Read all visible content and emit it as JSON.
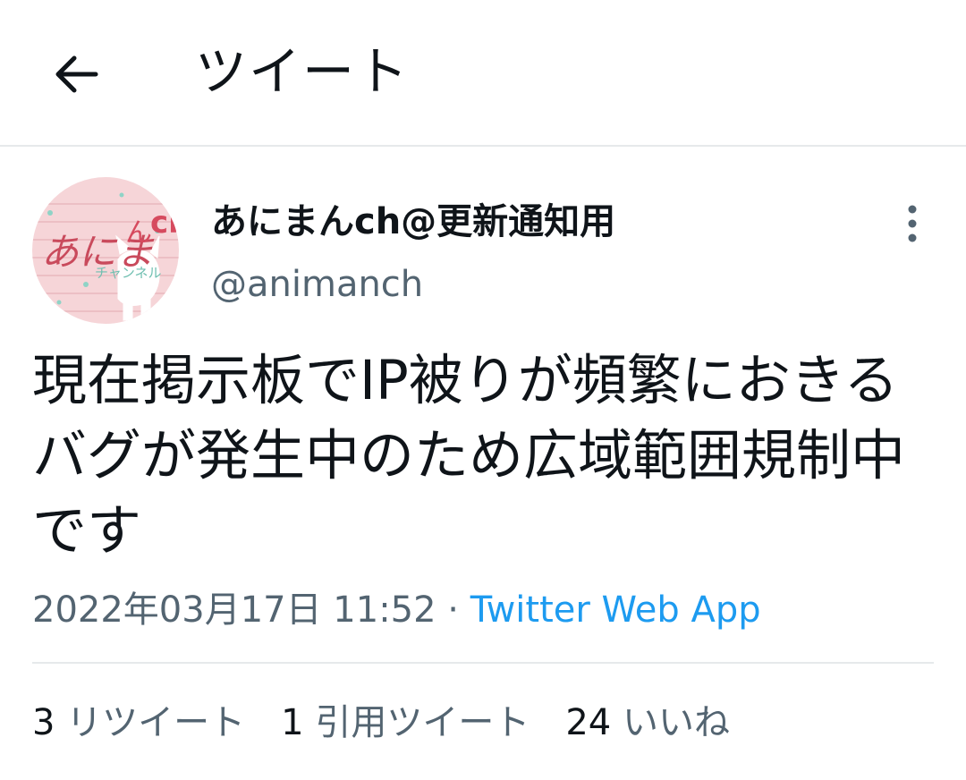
{
  "header": {
    "title": "ツイート",
    "back_icon": "arrow-left-icon"
  },
  "user": {
    "display_name": "あにまんch@更新通知用",
    "handle": "@animanch",
    "avatar_text": "あにまんch",
    "avatar_sub": "チャンネル"
  },
  "tweet": {
    "text": "現在掲示板でIP被りが頻繁におきるバグが発生中のため広域範囲規制中です",
    "timestamp": "2022年03月17日 11:52",
    "separator": " · ",
    "source": "Twitter Web App"
  },
  "stats": {
    "retweets_count": "3",
    "retweets_label": "リツイート",
    "quotes_count": "1",
    "quotes_label": "引用ツイート",
    "likes_count": "24",
    "likes_label": "いいね"
  },
  "colors": {
    "text": "#0f1419",
    "secondary": "#536471",
    "accent": "#1d9bf0",
    "divider": "#e6e9eb",
    "avatar_bg": "#f6d5d8"
  }
}
